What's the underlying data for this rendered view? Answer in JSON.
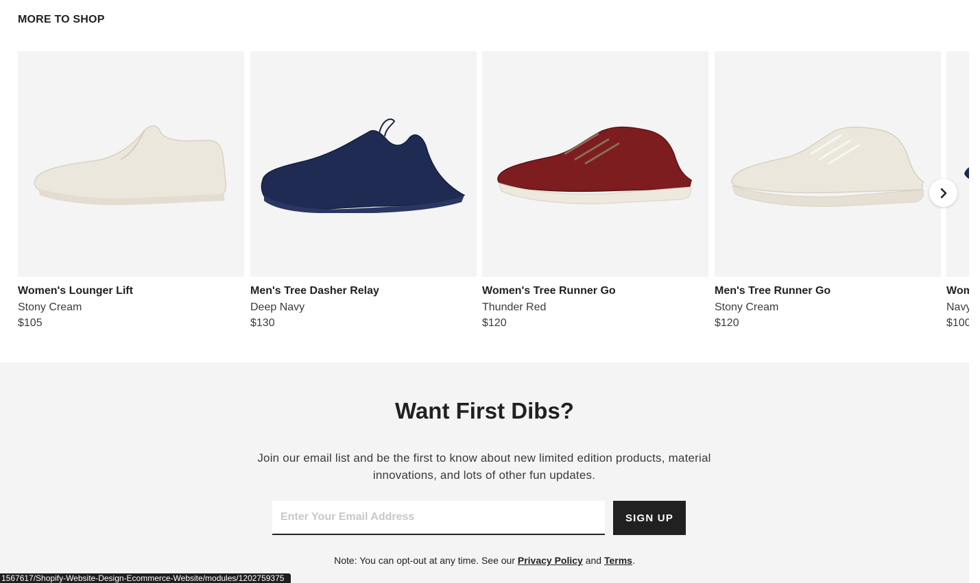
{
  "section_title": "MORE TO SHOP",
  "products": [
    {
      "name": "Women's Lounger Lift",
      "color": "Stony Cream",
      "price": "$105"
    },
    {
      "name": "Men's Tree Dasher Relay",
      "color": "Deep Navy",
      "price": "$130"
    },
    {
      "name": "Women's Tree Runner Go",
      "color": "Thunder Red",
      "price": "$120"
    },
    {
      "name": "Men's Tree Runner Go",
      "color": "Stony Cream",
      "price": "$120"
    },
    {
      "name": "Women's Tree Lounger",
      "color": "Navy",
      "price": "$100"
    }
  ],
  "signup": {
    "title": "Want First Dibs?",
    "description": "Join our email list and be the first to know about new limited edition products, material innovations, and lots of other fun updates.",
    "email_placeholder": "Enter Your Email Address",
    "button_label": "SIGN UP",
    "note_prefix": "Note: You can opt-out at any time. See our",
    "privacy_link": "Privacy Policy",
    "note_and": "and",
    "terms_link": "Terms",
    "note_suffix": "."
  },
  "status_bar_url": "1567617/Shopify-Website-Design-Ecommerce-Website/modules/1202759375",
  "colors": {
    "background": "#ffffff",
    "panel": "#f4f4f4",
    "text": "#212121",
    "button": "#212121",
    "shoe_cream": "#ebe6dc",
    "shoe_navy": "#1e2a4f",
    "shoe_red": "#7e1c1f"
  }
}
